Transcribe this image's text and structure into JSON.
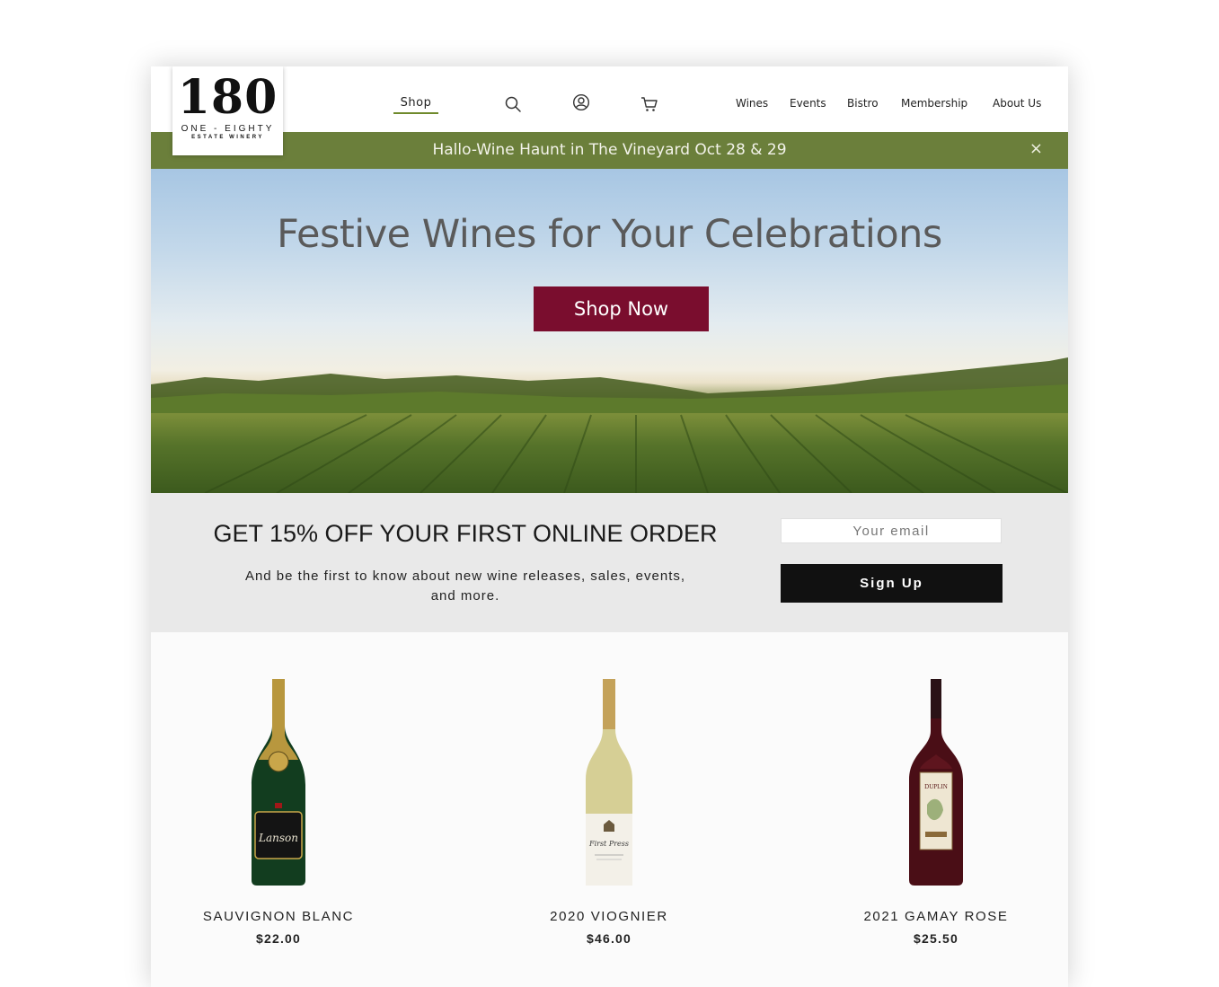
{
  "brand": {
    "logo_number": "180",
    "logo_line1": "ONE - EIGHTY",
    "logo_line2": "ESTATE WINERY"
  },
  "nav": {
    "shop": "Shop",
    "icons": [
      "search-icon",
      "account-icon",
      "cart-icon"
    ],
    "links": [
      "Wines",
      "Events",
      "Bistro",
      "Membership",
      "About Us"
    ]
  },
  "announcement": {
    "text": "Hallo-Wine Haunt in The Vineyard Oct 28 & 29",
    "close": "×"
  },
  "hero": {
    "title": "Festive Wines for Your Celebrations",
    "cta": "Shop Now"
  },
  "signup": {
    "title": "GET 15% OFF YOUR FIRST ONLINE ORDER",
    "subtitle": "And be the first to know about new wine releases, sales, events, and more.",
    "email_placeholder": "Your email",
    "button": "Sign Up"
  },
  "products": [
    {
      "name": "SAUVIGNON BLANC",
      "price": "$22.00",
      "label": "Lanson"
    },
    {
      "name": "2020 VIOGNIER",
      "price": "$46.00",
      "label": "First Press"
    },
    {
      "name": "2021 GAMAY ROSE",
      "price": "$25.50",
      "label": "DUPLIN"
    }
  ],
  "colors": {
    "accent_green": "#6b7f3b",
    "cta_burgundy": "#7a0d2e",
    "signup_bg": "#e9e9e9"
  }
}
